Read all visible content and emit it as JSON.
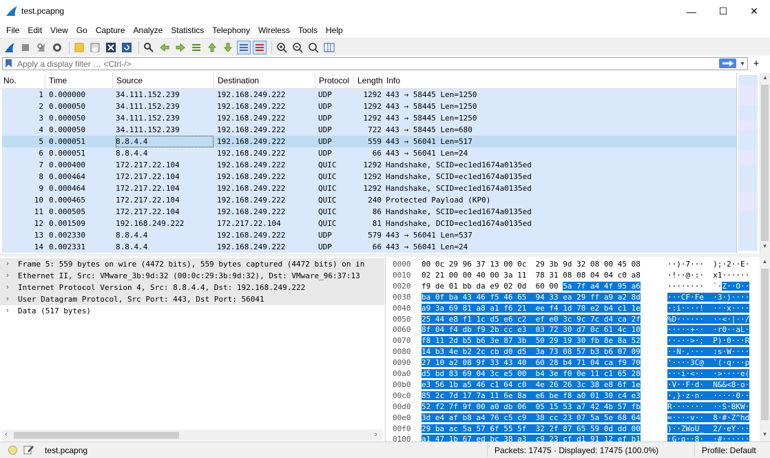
{
  "window": {
    "title": "test.pcapng",
    "minimize": "—",
    "maximize": "☐",
    "close": "✕"
  },
  "menu": [
    "File",
    "Edit",
    "View",
    "Go",
    "Capture",
    "Analyze",
    "Statistics",
    "Telephony",
    "Wireless",
    "Tools",
    "Help"
  ],
  "toolbar_icons": [
    "shark-fin-start-icon",
    "stop-capture-icon",
    "restart-capture-icon",
    "capture-options-icon",
    "open-file-icon",
    "save-file-icon",
    "close-file-icon",
    "reload-file-icon",
    "find-packet-icon",
    "go-back-icon",
    "go-forward-icon",
    "go-to-packet-icon",
    "first-packet-icon",
    "last-packet-icon",
    "autoscroll-icon",
    "colorize-icon",
    "zoom-in-icon",
    "zoom-out-icon",
    "normal-size-icon",
    "resize-columns-icon"
  ],
  "filter": {
    "placeholder": "Apply a display filter … <Ctrl-/>",
    "value": "",
    "apply_icon": "arrow-right-icon",
    "add_button": "+"
  },
  "columns": [
    "No.",
    "Time",
    "Source",
    "Destination",
    "Protocol",
    "Length",
    "Info"
  ],
  "packets": [
    {
      "no": "1",
      "time": "0.000000",
      "src": "34.111.152.239",
      "dst": "192.168.249.222",
      "proto": "UDP",
      "len": "1292",
      "info": "443 → 58445 Len=1250"
    },
    {
      "no": "2",
      "time": "0.000050",
      "src": "34.111.152.239",
      "dst": "192.168.249.222",
      "proto": "UDP",
      "len": "1292",
      "info": "443 → 58445 Len=1250"
    },
    {
      "no": "3",
      "time": "0.000050",
      "src": "34.111.152.239",
      "dst": "192.168.249.222",
      "proto": "UDP",
      "len": "1292",
      "info": "443 → 58445 Len=1250"
    },
    {
      "no": "4",
      "time": "0.000050",
      "src": "34.111.152.239",
      "dst": "192.168.249.222",
      "proto": "UDP",
      "len": "722",
      "info": "443 → 58445 Len=680"
    },
    {
      "no": "5",
      "time": "0.000051",
      "src": "8.8.4.4",
      "dst": "192.168.249.222",
      "proto": "UDP",
      "len": "559",
      "info": "443 → 56041 Len=517"
    },
    {
      "no": "6",
      "time": "0.000051",
      "src": "8.8.4.4",
      "dst": "192.168.249.222",
      "proto": "UDP",
      "len": "66",
      "info": "443 → 56041 Len=24"
    },
    {
      "no": "7",
      "time": "0.000400",
      "src": "172.217.22.104",
      "dst": "192.168.249.222",
      "proto": "QUIC",
      "len": "1292",
      "info": "Handshake, SCID=ec1ed1674a0135ed"
    },
    {
      "no": "8",
      "time": "0.000464",
      "src": "172.217.22.104",
      "dst": "192.168.249.222",
      "proto": "QUIC",
      "len": "1292",
      "info": "Handshake, SCID=ec1ed1674a0135ed"
    },
    {
      "no": "9",
      "time": "0.000464",
      "src": "172.217.22.104",
      "dst": "192.168.249.222",
      "proto": "QUIC",
      "len": "1292",
      "info": "Handshake, SCID=ec1ed1674a0135ed"
    },
    {
      "no": "10",
      "time": "0.000465",
      "src": "172.217.22.104",
      "dst": "192.168.249.222",
      "proto": "QUIC",
      "len": "240",
      "info": "Protected Payload (KP0)"
    },
    {
      "no": "11",
      "time": "0.000505",
      "src": "172.217.22.104",
      "dst": "192.168.249.222",
      "proto": "QUIC",
      "len": "86",
      "info": "Handshake, SCID=ec1ed1674a0135ed"
    },
    {
      "no": "12",
      "time": "0.001509",
      "src": "192.168.249.222",
      "dst": "172.217.22.104",
      "proto": "QUIC",
      "len": "81",
      "info": "Handshake, DCID=ec1ed1674a0135ed"
    },
    {
      "no": "13",
      "time": "0.002330",
      "src": "8.8.4.4",
      "dst": "192.168.249.222",
      "proto": "UDP",
      "len": "579",
      "info": "443 → 56041 Len=537"
    },
    {
      "no": "14",
      "time": "0.002331",
      "src": "8.8.4.4",
      "dst": "192.168.249.222",
      "proto": "UDP",
      "len": "66",
      "info": "443 → 56041 Len=24"
    }
  ],
  "selected_packet": "5",
  "details": [
    "Frame 5: 559 bytes on wire (4472 bits), 559 bytes captured (4472 bits) on in",
    "Ethernet II, Src: VMware_3b:9d:32 (00:0c:29:3b:9d:32), Dst: VMware_96:37:13",
    "Internet Protocol Version 4, Src: 8.8.4.4, Dst: 192.168.249.222",
    "User Datagram Protocol, Src Port: 443, Dst Port: 56041",
    "Data (517 bytes)"
  ],
  "bytes": [
    {
      "off": "0000",
      "pre": "00 0c 29 96 37 13 00 0c  29 3b 9d 32 08 00 45 08",
      "hl": "",
      "apre": "··)·7···  );·2··E·",
      "ahl": ""
    },
    {
      "off": "0010",
      "pre": "02 21 00 00 40 00 3a 11  78 31 08 08 04 04 c0 a8",
      "hl": "",
      "apre": "·!··@·:·  x1······",
      "ahl": ""
    },
    {
      "off": "0020",
      "pre": "f9 de 01 bb da e9 02 0d  60 00 ",
      "hl": "5a 7f a4 4f 95 a6",
      "apre": "········  `·",
      "ahl": "Z··O··"
    },
    {
      "off": "0030",
      "pre": "",
      "hl": "ba 0f ba 43 46 f5 46 65  94 33 ea 29 ff a9 a2 8d",
      "apre": "",
      "ahl": "···CF·Fe  ·3·)····"
    },
    {
      "off": "0040",
      "pre": "",
      "hl": "a9 3a 69 81 a8 a1 f6 21  ee f4 1d 78 e2 b4 c1 1e",
      "apre": "",
      "ahl": "·:i····!  ···x····"
    },
    {
      "off": "0050",
      "pre": "",
      "hl": "25 44 e8 f1 1c d5 e6 c2  ef e0 3c 9c 7c d4 ca 2f",
      "apre": "",
      "ahl": "%D······  ··<·|··/"
    },
    {
      "off": "0060",
      "pre": "",
      "hl": "8f 04 f4 db f9 2b cc e3  03 72 30 d7 0c 61 4c 10",
      "apre": "",
      "ahl": "·····+··  ·r0··aL·"
    },
    {
      "off": "0070",
      "pre": "",
      "hl": "f8 11 2d b5 b6 3e 87 3b  50 29 19 30 fb 8e 8a 52",
      "apre": "",
      "ahl": "··-··>·;  P)·0···R"
    },
    {
      "off": "0080",
      "pre": "",
      "hl": "14 b3 4e b2 2c cb d0 d5  3a 73 08 57 b3 b6 07 09",
      "apre": "",
      "ahl": "··N·,···  :s·W····"
    },
    {
      "off": "0090",
      "pre": "",
      "hl": "27 10 a2 08 9f 33 43 40  60 28 b4 71 04 ca f9 70",
      "apre": "",
      "ahl": "'····3C@  `(·q···p"
    },
    {
      "off": "00a0",
      "pre": "",
      "hl": "d5 bd 83 69 04 3c e5 00  b4 3e f0 0e 11 c1 65 28",
      "apre": "",
      "ahl": "···i·<··  ·>····e("
    },
    {
      "off": "00b0",
      "pre": "",
      "hl": "e3 56 1b a5 46 c1 64 c0  4e 26 26 3c 38 e8 6f 1e",
      "apre": "",
      "ahl": "·V··F·d·  N&&<8·o·"
    },
    {
      "off": "00c0",
      "pre": "",
      "hl": "85 2c 7d 17 7a 11 6e 8a  e6 be f8 a0 01 30 c4 e3",
      "apre": "",
      "ahl": "·,}·z·n·  ·····0··"
    },
    {
      "off": "00d0",
      "pre": "",
      "hl": "52 f2 7f 9f 00 a0 db 06  05 15 53 a7 42 4b 57 fb",
      "apre": "",
      "ahl": "R·······  ··S·BKW·"
    },
    {
      "off": "00e0",
      "pre": "",
      "hl": "3d e4 af b8 a4 76 c5 c9  38 cc 23 07 5a 5e 68 64",
      "apre": "",
      "ahl": "=····v··  8·#·Z^hd"
    },
    {
      "off": "00f0",
      "pre": "",
      "hl": "29 ba ac 5a 57 6f 55 5f  32 2f 87 65 59 0d dd 00",
      "apre": "",
      "ahl": ")··ZWoU_  2/·eY···"
    },
    {
      "off": "0100",
      "pre": "",
      "hl": "a1 47 1b 67 ed bc 38 a3  c9 23 cf d1 91 12 ef b1",
      "apre": "",
      "ahl": "·G·g··8·  ·#······"
    }
  ],
  "status": {
    "file": "test.pcapng",
    "packets": "Packets: 17475 · Displayed: 17475 (100.0%)",
    "profile": "Profile: Default"
  },
  "colors": {
    "row_bg": "#dae8fc",
    "selected_bg": "#c0dcf3",
    "hex_highlight": "#0a78d7",
    "apply_button": "#4a86e8"
  }
}
